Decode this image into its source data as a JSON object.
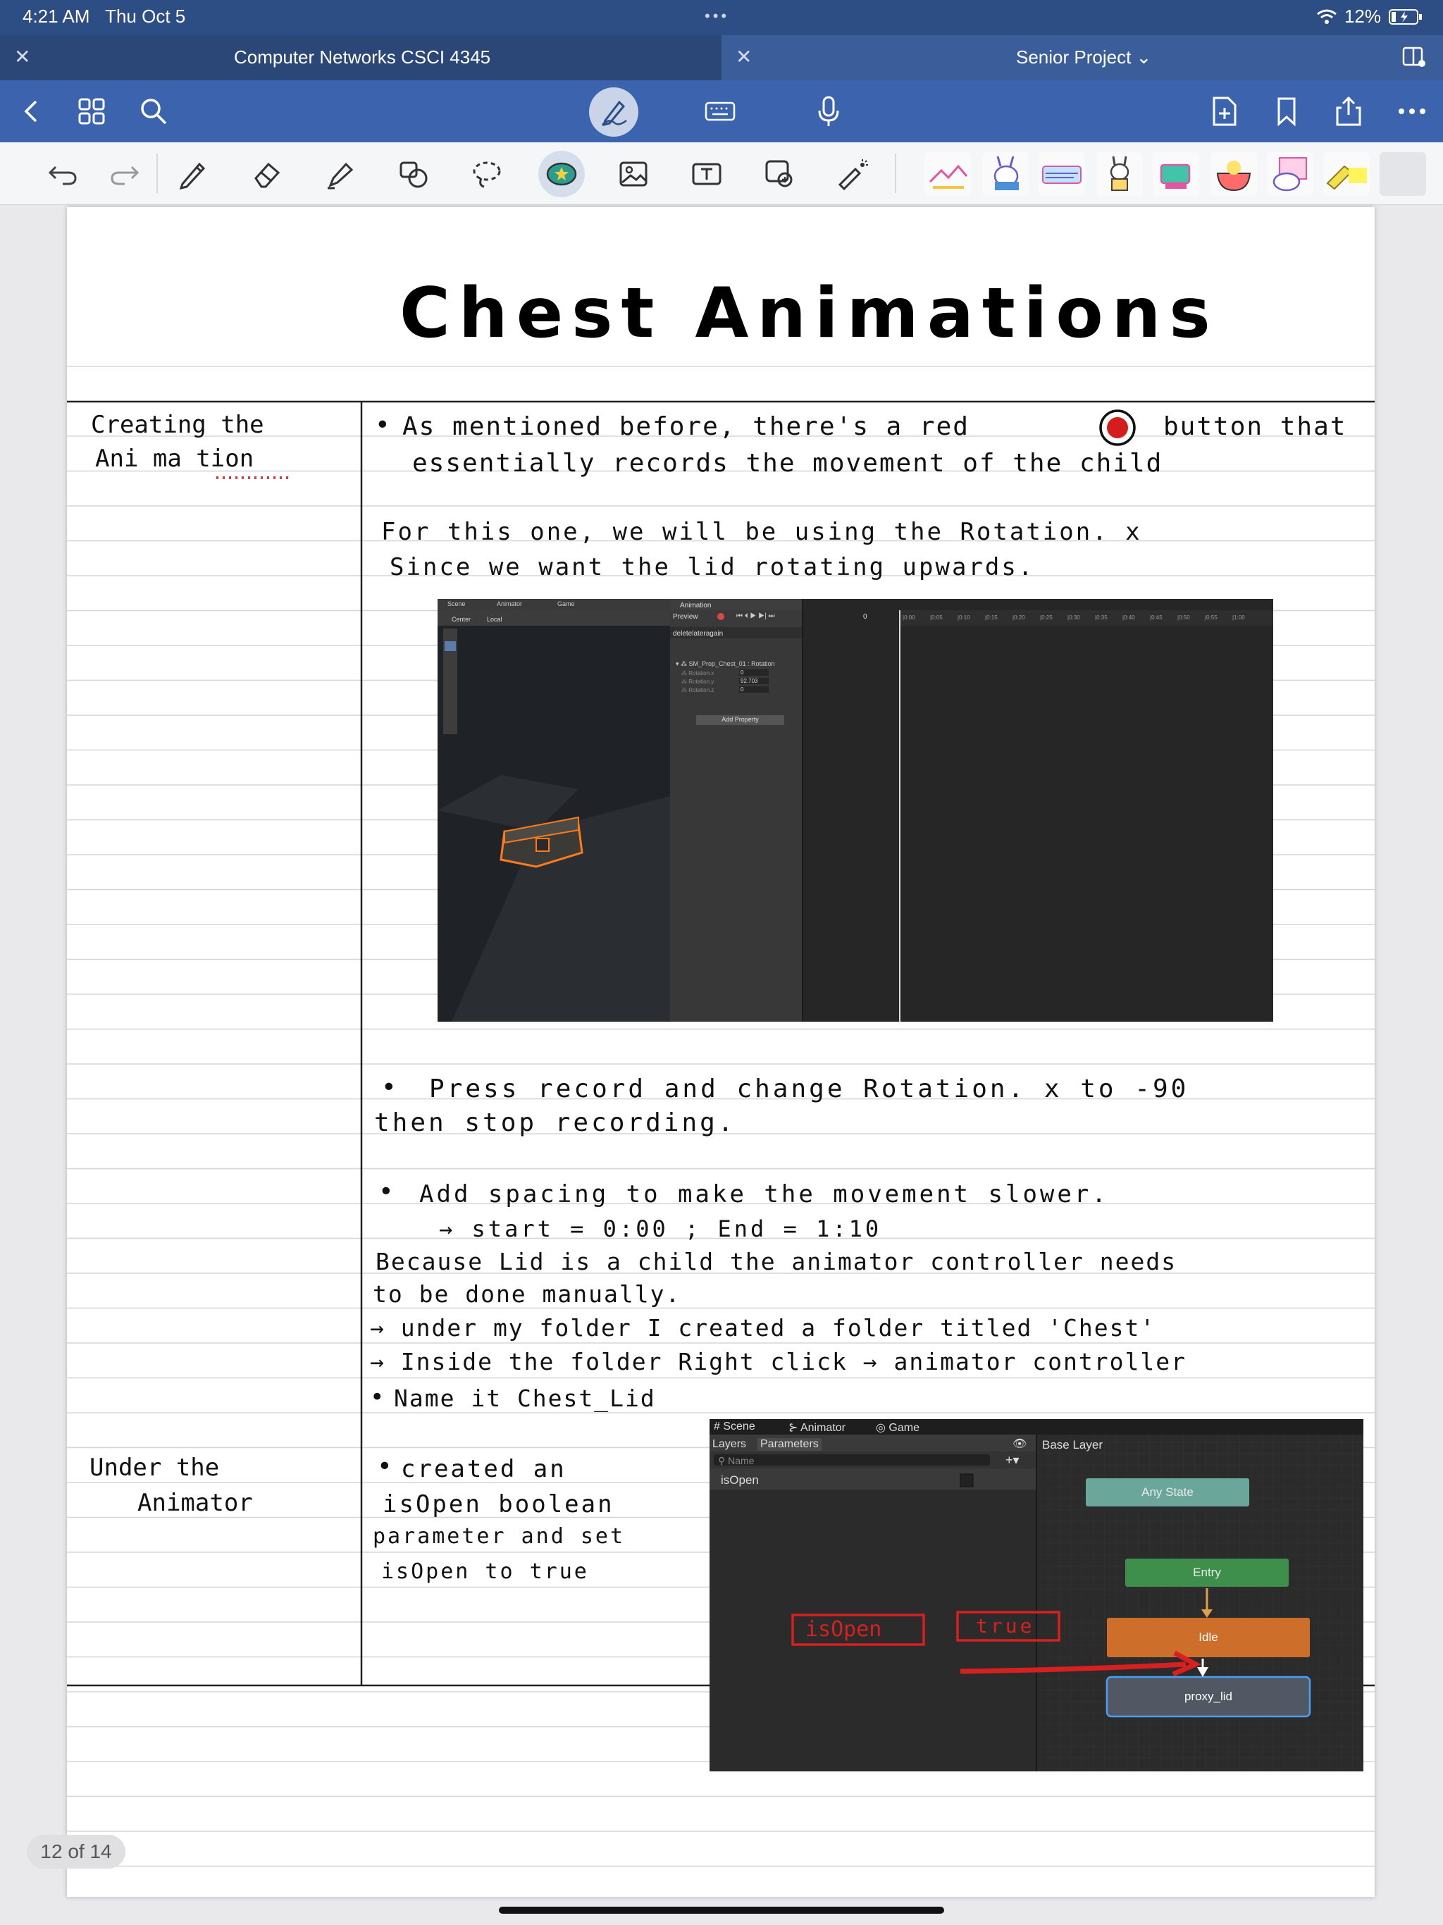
{
  "status": {
    "time": "4:21 AM",
    "date": "Thu Oct 5",
    "battery": "12%"
  },
  "tabs": [
    {
      "label": "Computer Networks CSCI 4345"
    },
    {
      "label": "Senior Project"
    }
  ],
  "toolbar_icons": [
    "back-icon",
    "grid-icon",
    "search-icon",
    "pen-mode-icon",
    "keyboard-icon",
    "microphone-icon",
    "add-page-icon",
    "bookmark-icon",
    "share-icon",
    "more-icon"
  ],
  "tools": [
    "undo-icon",
    "redo-icon",
    "pen-icon",
    "eraser-icon",
    "highlighter-icon",
    "shapes-icon",
    "lasso-icon",
    "sticker-icon",
    "image-icon",
    "text-icon",
    "camera-icon",
    "laser-icon"
  ],
  "note": {
    "title": "Chest Animations",
    "cue1": [
      "Creating the",
      "Ani ma tion"
    ],
    "cue2": [
      "Under the",
      "Animator"
    ],
    "p1": [
      "As mentioned before, there's a red",
      "button that",
      "essentially records the movement of the child"
    ],
    "p2": [
      "For this one, we will be using the Rotation. x",
      "Since we want the lid rotating upwards."
    ],
    "p3": [
      "Press record and change Rotation. x to -90",
      "then stop recording."
    ],
    "p4": [
      "Add spacing to make the movement slower.",
      "→ start = 0:00 ; End = 1:10"
    ],
    "p5": [
      "Because Lid is a child the animator controller needs",
      "to be done manually."
    ],
    "p6": [
      "→ under my folder I created a folder titled 'Chest'",
      "→ Inside the folder Right click → animator controller",
      "Name it Chest_Lid"
    ],
    "p7": [
      "created an",
      "isOpen boolean",
      "parameter and set",
      "isOpen to true"
    ]
  },
  "shot1": {
    "tabs": [
      "Scene",
      "Animator",
      "Game"
    ],
    "toolbar": [
      "Center",
      "Local"
    ],
    "anim_tab": "Animation",
    "preview": "Preview",
    "frame": "0",
    "clip": "deletelateragain",
    "object": "SM_Prop_Chest_01 : Rotation",
    "props": [
      {
        "name": "Rotation.x",
        "value": "0"
      },
      {
        "name": "Rotation.y",
        "value": "92.703"
      },
      {
        "name": "Rotation.z",
        "value": "0"
      }
    ],
    "add_property": "Add Property",
    "ticks": [
      "0:00",
      "0:05",
      "0:10",
      "0:15",
      "0:20",
      "0:25",
      "0:30",
      "0:35",
      "0:40",
      "0:45",
      "0:50",
      "0:55",
      "1:00"
    ]
  },
  "shot2": {
    "tabs": [
      "Scene",
      "Animator",
      "Game"
    ],
    "panel_tabs": [
      "Layers",
      "Parameters"
    ],
    "search_placeholder": "Name",
    "param": "isOpen",
    "layer": "Base Layer",
    "nodes": [
      "Any State",
      "Entry",
      "Idle",
      "proxy_lid"
    ],
    "annot1": "isOpen",
    "annot2": "true"
  },
  "page_indicator": "12 of 14"
}
